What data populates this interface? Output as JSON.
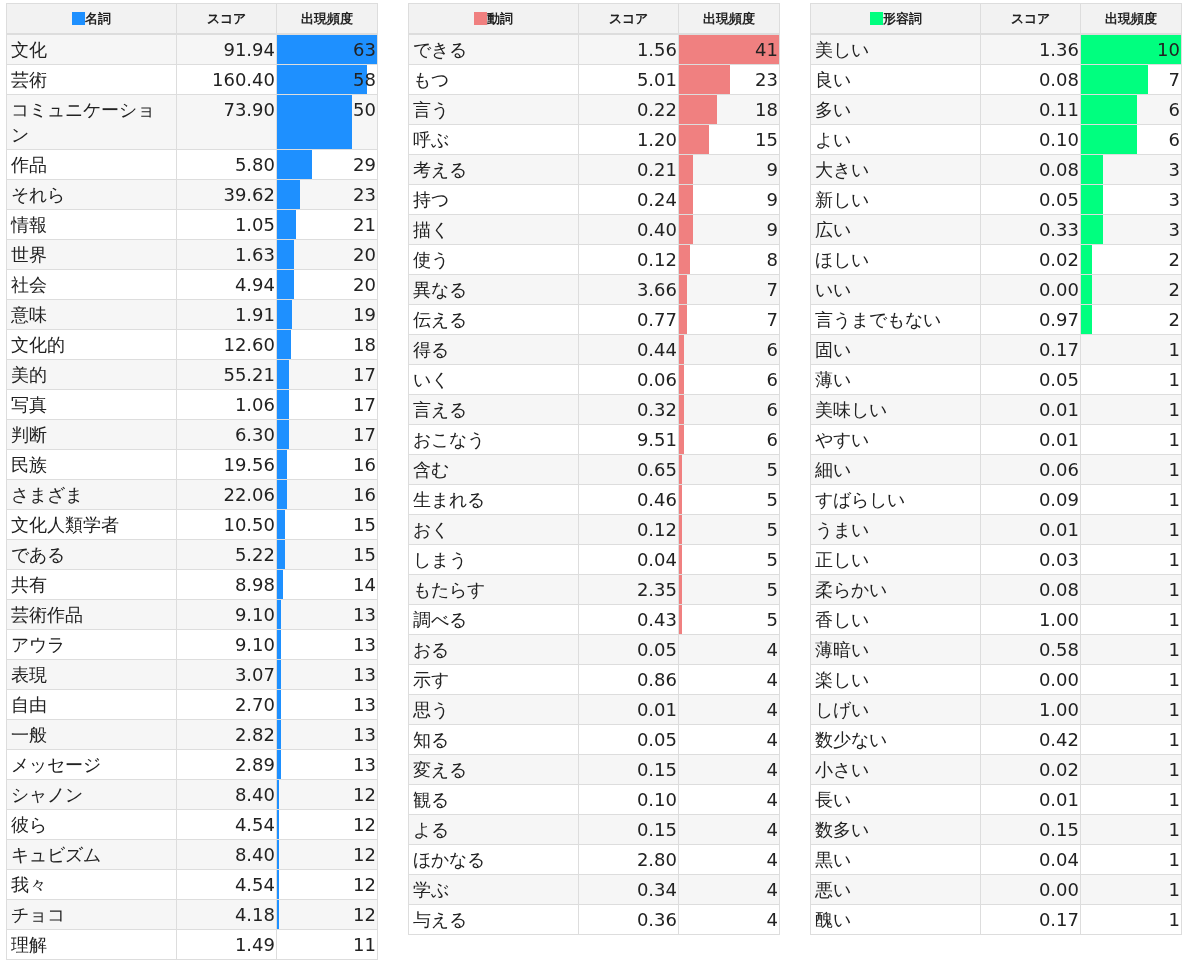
{
  "tables": [
    {
      "color": "#1e90ff",
      "columns": [
        "名詞",
        "スコア",
        "出現頻度"
      ],
      "rows": [
        {
          "word": "文化",
          "score": "91.94",
          "freq": "63",
          "level": 1
        },
        {
          "word": "芸術",
          "score": "160.40",
          "freq": "58",
          "level": 0.904
        },
        {
          "word": "コミュニケーション",
          "score": "73.90",
          "freq": "50",
          "level": 0.75
        },
        {
          "word": "作品",
          "score": "5.80",
          "freq": "29",
          "level": 0.346
        },
        {
          "word": "それら",
          "score": "39.62",
          "freq": "23",
          "level": 0.231
        },
        {
          "word": "情報",
          "score": "1.05",
          "freq": "21",
          "level": 0.192
        },
        {
          "word": "世界",
          "score": "1.63",
          "freq": "20",
          "level": 0.173
        },
        {
          "word": "社会",
          "score": "4.94",
          "freq": "20",
          "level": 0.173
        },
        {
          "word": "意味",
          "score": "1.91",
          "freq": "19",
          "level": 0.154
        },
        {
          "word": "文化的",
          "score": "12.60",
          "freq": "18",
          "level": 0.135
        },
        {
          "word": "美的",
          "score": "55.21",
          "freq": "17",
          "level": 0.115
        },
        {
          "word": "写真",
          "score": "1.06",
          "freq": "17",
          "level": 0.115
        },
        {
          "word": "判断",
          "score": "6.30",
          "freq": "17",
          "level": 0.115
        },
        {
          "word": "民族",
          "score": "19.56",
          "freq": "16",
          "level": 0.096
        },
        {
          "word": "さまざま",
          "score": "22.06",
          "freq": "16",
          "level": 0.096
        },
        {
          "word": "文化人類学者",
          "score": "10.50",
          "freq": "15",
          "level": 0.077
        },
        {
          "word": "である",
          "score": "5.22",
          "freq": "15",
          "level": 0.077
        },
        {
          "word": "共有",
          "score": "8.98",
          "freq": "14",
          "level": 0.058
        },
        {
          "word": "芸術作品",
          "score": "9.10",
          "freq": "13",
          "level": 0.038
        },
        {
          "word": "アウラ",
          "score": "9.10",
          "freq": "13",
          "level": 0.038
        },
        {
          "word": "表現",
          "score": "3.07",
          "freq": "13",
          "level": 0.038
        },
        {
          "word": "自由",
          "score": "2.70",
          "freq": "13",
          "level": 0.038
        },
        {
          "word": "一般",
          "score": "2.82",
          "freq": "13",
          "level": 0.038
        },
        {
          "word": "メッセージ",
          "score": "2.89",
          "freq": "13",
          "level": 0.038
        },
        {
          "word": "シャノン",
          "score": "8.40",
          "freq": "12",
          "level": 0.019
        },
        {
          "word": "彼ら",
          "score": "4.54",
          "freq": "12",
          "level": 0.019
        },
        {
          "word": "キュビズム",
          "score": "8.40",
          "freq": "12",
          "level": 0.019
        },
        {
          "word": "我々",
          "score": "4.54",
          "freq": "12",
          "level": 0.019
        },
        {
          "word": "チョコ",
          "score": "4.18",
          "freq": "12",
          "level": 0.019
        },
        {
          "word": "理解",
          "score": "1.49",
          "freq": "11",
          "level": 0
        }
      ]
    },
    {
      "color": "#f08080",
      "columns": [
        "動詞",
        "スコア",
        "出現頻度"
      ],
      "rows": [
        {
          "word": "できる",
          "score": "1.56",
          "freq": "41",
          "level": 1
        },
        {
          "word": "もつ",
          "score": "5.01",
          "freq": "23",
          "level": 0.514
        },
        {
          "word": "言う",
          "score": "0.22",
          "freq": "18",
          "level": 0.378
        },
        {
          "word": "呼ぶ",
          "score": "1.20",
          "freq": "15",
          "level": 0.297
        },
        {
          "word": "考える",
          "score": "0.21",
          "freq": "9",
          "level": 0.135
        },
        {
          "word": "持つ",
          "score": "0.24",
          "freq": "9",
          "level": 0.135
        },
        {
          "word": "描く",
          "score": "0.40",
          "freq": "9",
          "level": 0.135
        },
        {
          "word": "使う",
          "score": "0.12",
          "freq": "8",
          "level": 0.108
        },
        {
          "word": "異なる",
          "score": "3.66",
          "freq": "7",
          "level": 0.081
        },
        {
          "word": "伝える",
          "score": "0.77",
          "freq": "7",
          "level": 0.081
        },
        {
          "word": "得る",
          "score": "0.44",
          "freq": "6",
          "level": 0.054
        },
        {
          "word": "いく",
          "score": "0.06",
          "freq": "6",
          "level": 0.054
        },
        {
          "word": "言える",
          "score": "0.32",
          "freq": "6",
          "level": 0.054
        },
        {
          "word": "おこなう",
          "score": "9.51",
          "freq": "6",
          "level": 0.054
        },
        {
          "word": "含む",
          "score": "0.65",
          "freq": "5",
          "level": 0.027
        },
        {
          "word": "生まれる",
          "score": "0.46",
          "freq": "5",
          "level": 0.027
        },
        {
          "word": "おく",
          "score": "0.12",
          "freq": "5",
          "level": 0.027
        },
        {
          "word": "しまう",
          "score": "0.04",
          "freq": "5",
          "level": 0.027
        },
        {
          "word": "もたらす",
          "score": "2.35",
          "freq": "5",
          "level": 0.027
        },
        {
          "word": "調べる",
          "score": "0.43",
          "freq": "5",
          "level": 0.027
        },
        {
          "word": "おる",
          "score": "0.05",
          "freq": "4",
          "level": 0
        },
        {
          "word": "示す",
          "score": "0.86",
          "freq": "4",
          "level": 0
        },
        {
          "word": "思う",
          "score": "0.01",
          "freq": "4",
          "level": 0
        },
        {
          "word": "知る",
          "score": "0.05",
          "freq": "4",
          "level": 0
        },
        {
          "word": "変える",
          "score": "0.15",
          "freq": "4",
          "level": 0
        },
        {
          "word": "観る",
          "score": "0.10",
          "freq": "4",
          "level": 0
        },
        {
          "word": "よる",
          "score": "0.15",
          "freq": "4",
          "level": 0
        },
        {
          "word": "ほかなる",
          "score": "2.80",
          "freq": "4",
          "level": 0
        },
        {
          "word": "学ぶ",
          "score": "0.34",
          "freq": "4",
          "level": 0
        },
        {
          "word": "与える",
          "score": "0.36",
          "freq": "4",
          "level": 0
        }
      ]
    },
    {
      "color": "#00ff7f",
      "columns": [
        "形容詞",
        "スコア",
        "出現頻度"
      ],
      "rows": [
        {
          "word": "美しい",
          "score": "1.36",
          "freq": "10",
          "level": 1
        },
        {
          "word": "良い",
          "score": "0.08",
          "freq": "7",
          "level": 0.667
        },
        {
          "word": "多い",
          "score": "0.11",
          "freq": "6",
          "level": 0.556
        },
        {
          "word": "よい",
          "score": "0.10",
          "freq": "6",
          "level": 0.556
        },
        {
          "word": "大きい",
          "score": "0.08",
          "freq": "3",
          "level": 0.222
        },
        {
          "word": "新しい",
          "score": "0.05",
          "freq": "3",
          "level": 0.222
        },
        {
          "word": "広い",
          "score": "0.33",
          "freq": "3",
          "level": 0.222
        },
        {
          "word": "ほしい",
          "score": "0.02",
          "freq": "2",
          "level": 0.111
        },
        {
          "word": "いい",
          "score": "0.00",
          "freq": "2",
          "level": 0.111
        },
        {
          "word": "言うまでもない",
          "score": "0.97",
          "freq": "2",
          "level": 0.111
        },
        {
          "word": "固い",
          "score": "0.17",
          "freq": "1",
          "level": 0
        },
        {
          "word": "薄い",
          "score": "0.05",
          "freq": "1",
          "level": 0
        },
        {
          "word": "美味しい",
          "score": "0.01",
          "freq": "1",
          "level": 0
        },
        {
          "word": "やすい",
          "score": "0.01",
          "freq": "1",
          "level": 0
        },
        {
          "word": "細い",
          "score": "0.06",
          "freq": "1",
          "level": 0
        },
        {
          "word": "すばらしい",
          "score": "0.09",
          "freq": "1",
          "level": 0
        },
        {
          "word": "うまい",
          "score": "0.01",
          "freq": "1",
          "level": 0
        },
        {
          "word": "正しい",
          "score": "0.03",
          "freq": "1",
          "level": 0
        },
        {
          "word": "柔らかい",
          "score": "0.08",
          "freq": "1",
          "level": 0
        },
        {
          "word": "香しい",
          "score": "1.00",
          "freq": "1",
          "level": 0
        },
        {
          "word": "薄暗い",
          "score": "0.58",
          "freq": "1",
          "level": 0
        },
        {
          "word": "楽しい",
          "score": "0.00",
          "freq": "1",
          "level": 0
        },
        {
          "word": "しげい",
          "score": "1.00",
          "freq": "1",
          "level": 0
        },
        {
          "word": "数少ない",
          "score": "0.42",
          "freq": "1",
          "level": 0
        },
        {
          "word": "小さい",
          "score": "0.02",
          "freq": "1",
          "level": 0
        },
        {
          "word": "長い",
          "score": "0.01",
          "freq": "1",
          "level": 0
        },
        {
          "word": "数多い",
          "score": "0.15",
          "freq": "1",
          "level": 0
        },
        {
          "word": "黒い",
          "score": "0.04",
          "freq": "1",
          "level": 0
        },
        {
          "word": "悪い",
          "score": "0.00",
          "freq": "1",
          "level": 0
        },
        {
          "word": "醜い",
          "score": "0.17",
          "freq": "1",
          "level": 0
        }
      ]
    }
  ]
}
